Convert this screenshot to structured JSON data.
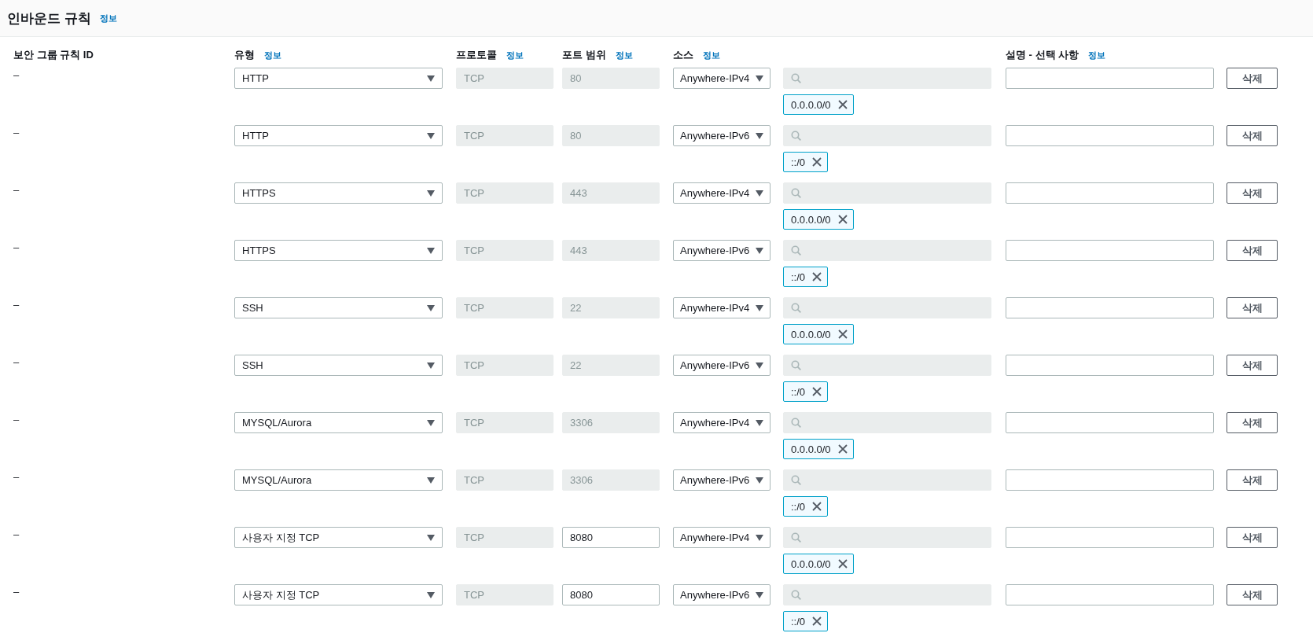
{
  "panel": {
    "title": "인바운드 규칙",
    "info_link": "정보"
  },
  "columns": [
    {
      "label": "보안 그룹 규칙 ID"
    },
    {
      "label": "유형",
      "info": "정보"
    },
    {
      "label": "프로토콜",
      "info": "정보"
    },
    {
      "label": "포트 범위",
      "info": "정보"
    },
    {
      "label": "소스",
      "info": "정보"
    },
    {
      "label": "설명 - 선택 사항",
      "info": "정보"
    }
  ],
  "rules": [
    {
      "id": "–",
      "type": "HTTP",
      "protocol": "TCP",
      "port": "80",
      "port_disabled": true,
      "source": "Anywhere-IPv4",
      "chip": "0.0.0.0/0",
      "delete": "삭제"
    },
    {
      "id": "–",
      "type": "HTTP",
      "protocol": "TCP",
      "port": "80",
      "port_disabled": true,
      "source": "Anywhere-IPv6",
      "chip": "::/0",
      "delete": "삭제"
    },
    {
      "id": "–",
      "type": "HTTPS",
      "protocol": "TCP",
      "port": "443",
      "port_disabled": true,
      "source": "Anywhere-IPv4",
      "chip": "0.0.0.0/0",
      "delete": "삭제"
    },
    {
      "id": "–",
      "type": "HTTPS",
      "protocol": "TCP",
      "port": "443",
      "port_disabled": true,
      "source": "Anywhere-IPv6",
      "chip": "::/0",
      "delete": "삭제"
    },
    {
      "id": "–",
      "type": "SSH",
      "protocol": "TCP",
      "port": "22",
      "port_disabled": true,
      "source": "Anywhere-IPv4",
      "chip": "0.0.0.0/0",
      "delete": "삭제"
    },
    {
      "id": "–",
      "type": "SSH",
      "protocol": "TCP",
      "port": "22",
      "port_disabled": true,
      "source": "Anywhere-IPv6",
      "chip": "::/0",
      "delete": "삭제"
    },
    {
      "id": "–",
      "type": "MYSQL/Aurora",
      "protocol": "TCP",
      "port": "3306",
      "port_disabled": true,
      "source": "Anywhere-IPv4",
      "chip": "0.0.0.0/0",
      "delete": "삭제"
    },
    {
      "id": "–",
      "type": "MYSQL/Aurora",
      "protocol": "TCP",
      "port": "3306",
      "port_disabled": true,
      "source": "Anywhere-IPv6",
      "chip": "::/0",
      "delete": "삭제"
    },
    {
      "id": "–",
      "type": "사용자 지정 TCP",
      "protocol": "TCP",
      "port": "8080",
      "port_disabled": false,
      "source": "Anywhere-IPv4",
      "chip": "0.0.0.0/0",
      "delete": "삭제"
    },
    {
      "id": "–",
      "type": "사용자 지정 TCP",
      "protocol": "TCP",
      "port": "8080",
      "port_disabled": false,
      "source": "Anywhere-IPv6",
      "chip": "::/0",
      "delete": "삭제"
    }
  ]
}
